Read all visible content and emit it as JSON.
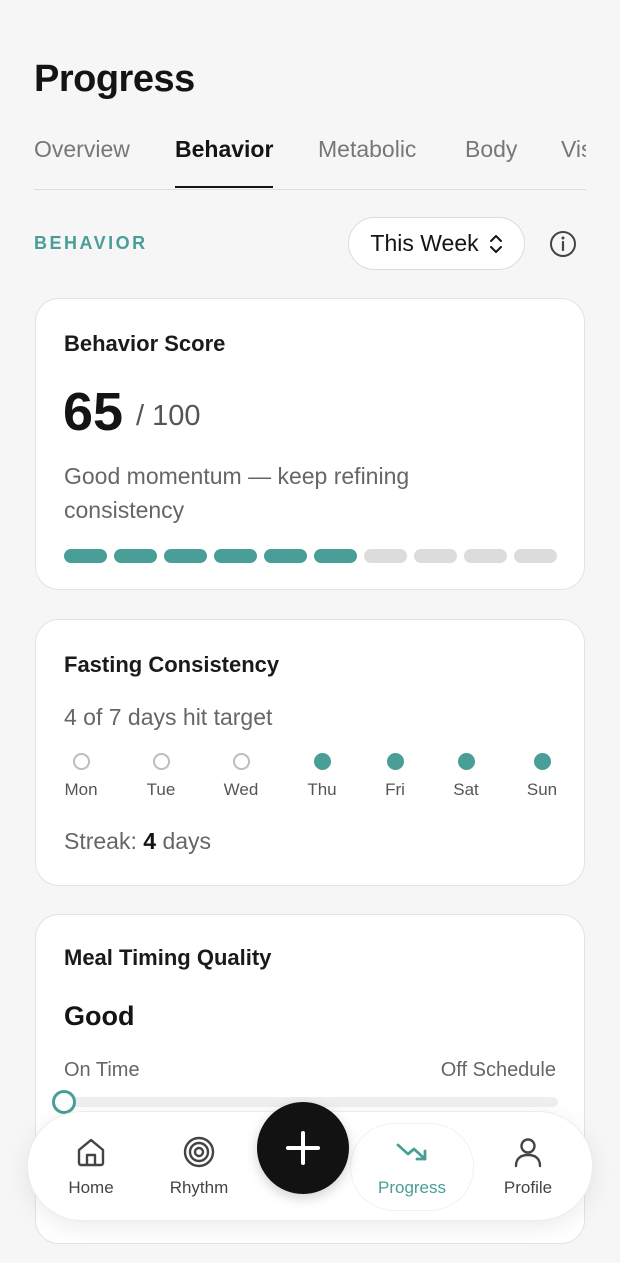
{
  "header": {
    "title": "Progress"
  },
  "tabs": [
    {
      "label": "Overview",
      "active": false
    },
    {
      "label": "Behavior",
      "active": true
    },
    {
      "label": "Metabolic",
      "active": false
    },
    {
      "label": "Body",
      "active": false
    },
    {
      "label": "Visuals",
      "active": false
    }
  ],
  "section": {
    "label": "BEHAVIOR",
    "period": "This Week",
    "info_icon": "info-icon"
  },
  "behavior_score": {
    "title": "Behavior Score",
    "value": "65",
    "max": "/ 100",
    "description": "Good momentum — keep refining consistency",
    "segments_total": 10,
    "segments_filled": 6,
    "accent_color": "#4a9e98"
  },
  "fasting": {
    "title": "Fasting Consistency",
    "summary": "4 of 7 days hit target",
    "days": [
      {
        "label": "Mon",
        "hit": false
      },
      {
        "label": "Tue",
        "hit": false
      },
      {
        "label": "Wed",
        "hit": false
      },
      {
        "label": "Thu",
        "hit": true
      },
      {
        "label": "Fri",
        "hit": true
      },
      {
        "label": "Sat",
        "hit": true
      },
      {
        "label": "Sun",
        "hit": true
      }
    ],
    "streak_prefix": "Streak:",
    "streak_value": "4",
    "streak_suffix": "days"
  },
  "meal_timing": {
    "title": "Meal Timing Quality",
    "quality": "Good",
    "scale_left": "On Time",
    "scale_right": "Off Schedule",
    "position_fraction": 0.0
  },
  "bottom_nav": {
    "items": [
      {
        "label": "Home",
        "icon": "home-icon",
        "active": false
      },
      {
        "label": "Rhythm",
        "icon": "target-icon",
        "active": false
      },
      {
        "label": "Progress",
        "icon": "trend-down-icon",
        "active": true
      },
      {
        "label": "Profile",
        "icon": "person-icon",
        "active": false
      }
    ],
    "add_icon": "plus-icon"
  }
}
